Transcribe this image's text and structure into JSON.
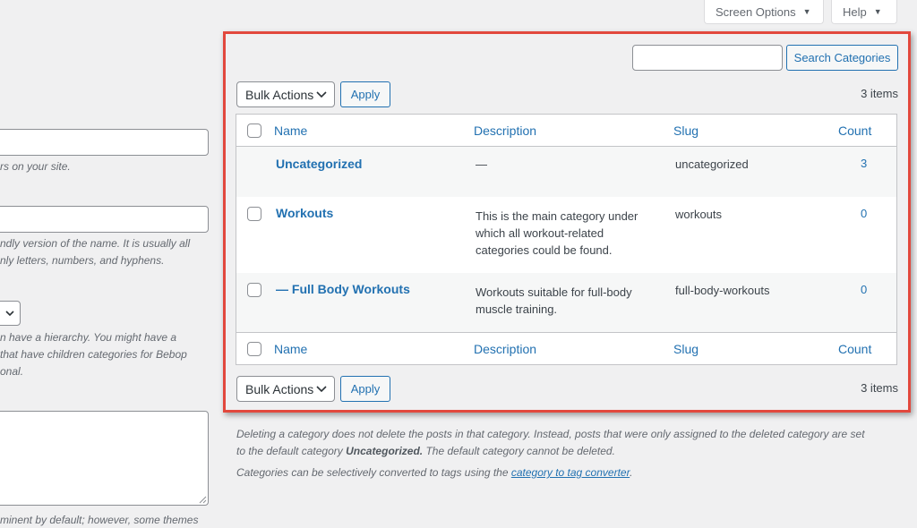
{
  "screen_meta": {
    "screen_options_label": "Screen Options",
    "help_label": "Help"
  },
  "left_form": {
    "name_note": "rs on your site.",
    "slug_note_1": "ndly version of the name. It is usually all",
    "slug_note_2": "nly letters, numbers, and hyphens.",
    "parent_note_1": "n have a hierarchy. You might have a",
    "parent_note_2": "that have children categories for Bebop",
    "parent_note_3": "onal.",
    "description_note": "minent by default; however, some themes"
  },
  "search": {
    "button_label": "Search Categories",
    "placeholder": ""
  },
  "bulk": {
    "top_label": "Bulk Actions",
    "bottom_label": "Bulk Actions",
    "apply_label": "Apply",
    "items_count": "3 items"
  },
  "table": {
    "columns": [
      "Name",
      "Description",
      "Slug",
      "Count"
    ],
    "rows": [
      {
        "name": "Uncategorized",
        "description_lines": [
          "—"
        ],
        "slug": "uncategorized",
        "count": "3",
        "has_checkbox": false
      },
      {
        "name": "Workouts",
        "description_lines": [
          "This is the main category under",
          "which all workout-related",
          "categories could be found."
        ],
        "slug": "workouts",
        "count": "0",
        "has_checkbox": true
      },
      {
        "name": "— Full Body Workouts",
        "description_lines": [
          "Workouts suitable for full-body",
          "muscle training."
        ],
        "slug": "full-body-workouts",
        "count": "0",
        "has_checkbox": true
      }
    ]
  },
  "help_text": {
    "line1": "Deleting a category does not delete the posts in that category. Instead, posts that were only assigned to the deleted category are set",
    "line2_prefix": "to the default category ",
    "line2_bold": "Uncategorized.",
    "line2_suffix": " The default category cannot be deleted.",
    "line3_prefix": "Categories can be selectively converted to tags using the ",
    "line3_link": "category to tag converter",
    "line3_suffix": "."
  },
  "colors": {
    "link": "#2271b1",
    "highlight": "#e2483d",
    "background": "#f0f0f1"
  }
}
